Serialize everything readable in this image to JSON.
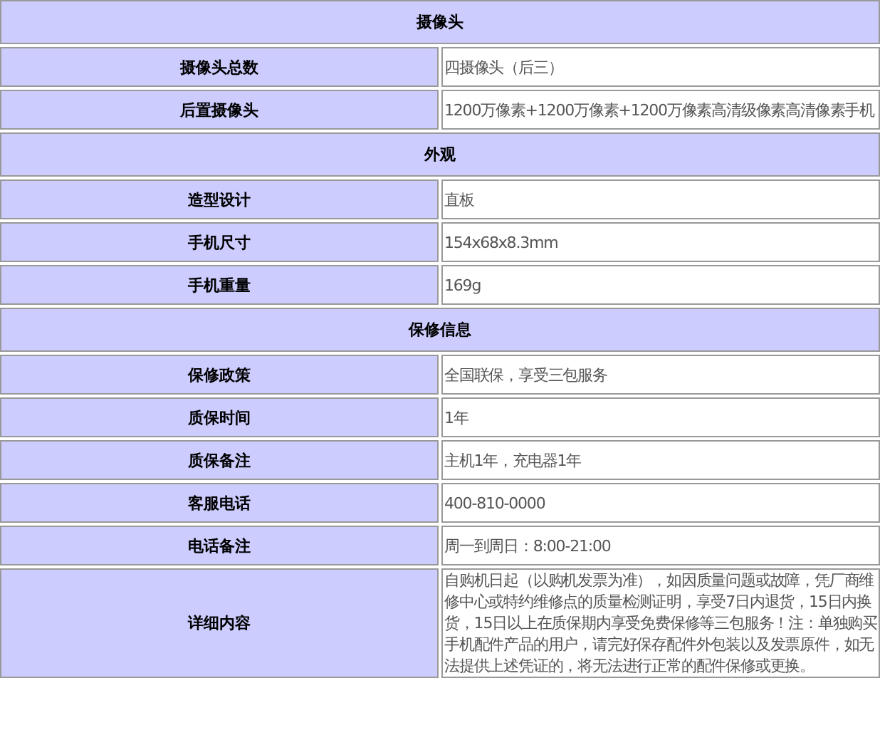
{
  "sections": [
    {
      "title": "摄像头",
      "rows": [
        {
          "label": "摄像头总数",
          "value": "四摄像头（后三）"
        },
        {
          "label": "后置摄像头",
          "value": "1200万像素+1200万像素+1200万像素高清级像素高清像素手机"
        }
      ]
    },
    {
      "title": "外观",
      "rows": [
        {
          "label": "造型设计",
          "value": "直板"
        },
        {
          "label": "手机尺寸",
          "value": "154x68x8.3mm"
        },
        {
          "label": "手机重量",
          "value": "169g"
        }
      ]
    },
    {
      "title": "保修信息",
      "rows": [
        {
          "label": "保修政策",
          "value": "全国联保，享受三包服务"
        },
        {
          "label": "质保时间",
          "value": "1年"
        },
        {
          "label": "质保备注",
          "value": "主机1年，充电器1年"
        },
        {
          "label": "客服电话",
          "value": "400-810-0000"
        },
        {
          "label": "电话备注",
          "value": "周一到周日：8:00-21:00"
        },
        {
          "label": "详细内容",
          "value": "自购机日起（以购机发票为准），如因质量问题或故障，凭厂商维修中心或特约维修点的质量检测证明，享受7日内退货，15日内换货，15日以上在质保期内享受免费保修等三包服务！注：单独购买手机配件产品的用户，请完好保存配件外包装以及发票原件，如无法提供上述凭证的，将无法进行正常的配件保修或更换。"
        }
      ]
    }
  ]
}
